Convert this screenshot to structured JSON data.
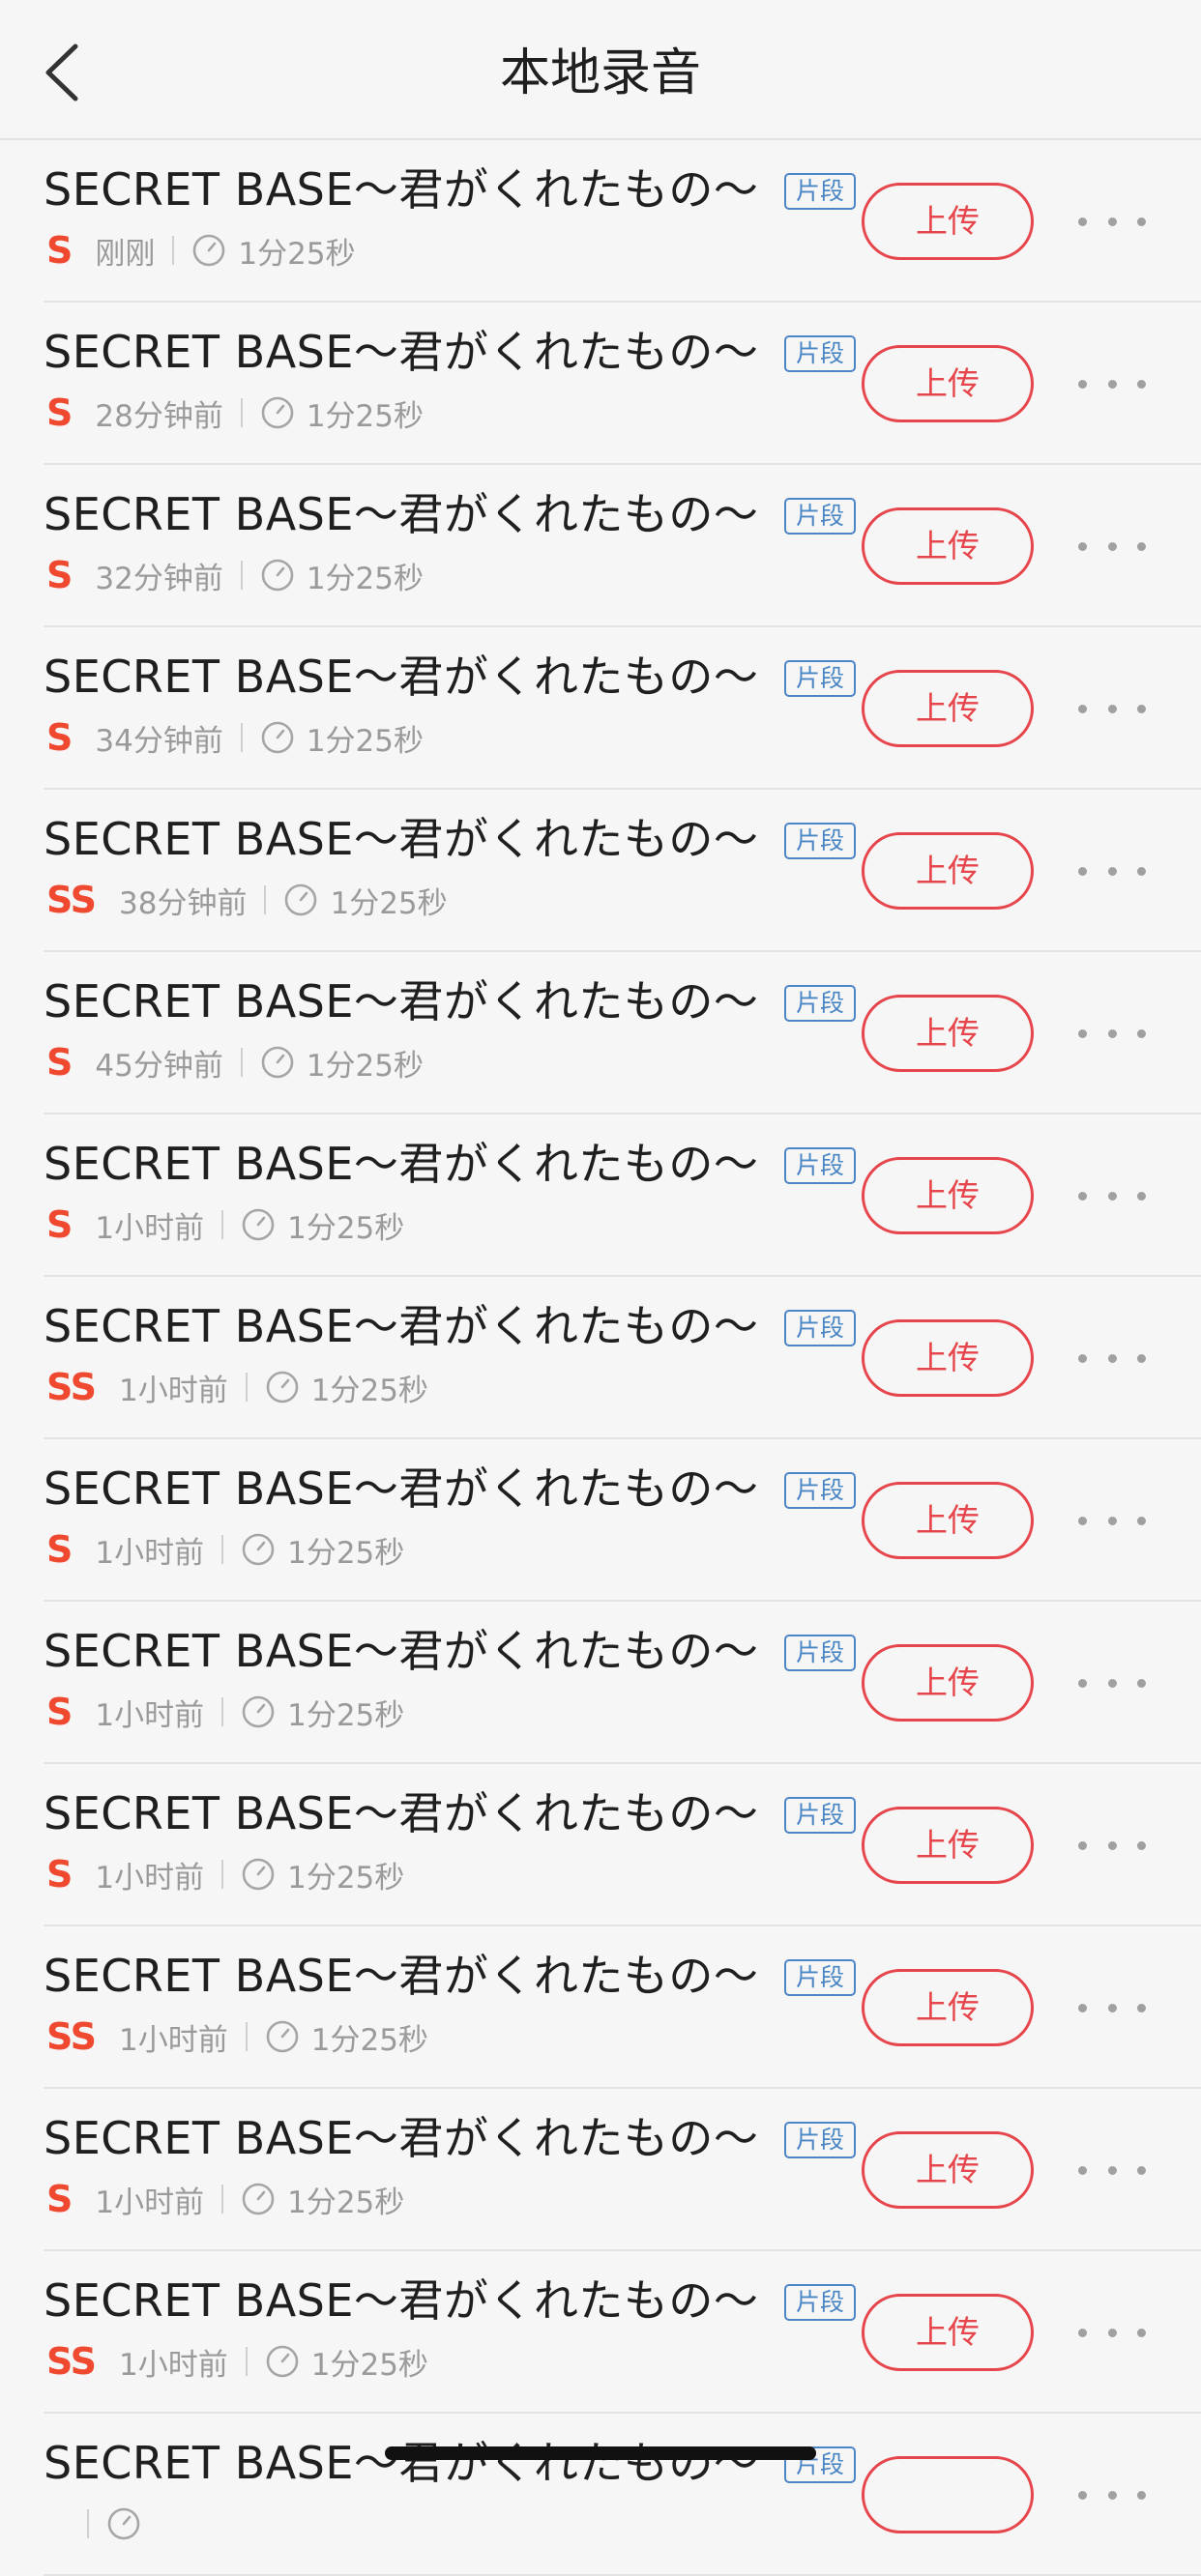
{
  "header": {
    "title": "本地录音",
    "back_icon": "chevron-left-icon"
  },
  "colors": {
    "accent_red": "#e6454b",
    "quality_orange": "#ef4a30",
    "tag_blue": "#4a86c4",
    "meta_gray": "#9a9a9a"
  },
  "recordings": [
    {
      "title": "SECRET BASE～君がくれたもの～",
      "tag": "片段",
      "quality": "S",
      "time": "刚刚",
      "duration": "1分25秒",
      "upload_label": "上传"
    },
    {
      "title": "SECRET BASE～君がくれたもの～",
      "tag": "片段",
      "quality": "S",
      "time": "28分钟前",
      "duration": "1分25秒",
      "upload_label": "上传"
    },
    {
      "title": "SECRET BASE～君がくれたもの～",
      "tag": "片段",
      "quality": "S",
      "time": "32分钟前",
      "duration": "1分25秒",
      "upload_label": "上传"
    },
    {
      "title": "SECRET BASE～君がくれたもの～",
      "tag": "片段",
      "quality": "S",
      "time": "34分钟前",
      "duration": "1分25秒",
      "upload_label": "上传"
    },
    {
      "title": "SECRET BASE～君がくれたもの～",
      "tag": "片段",
      "quality": "SS",
      "time": "38分钟前",
      "duration": "1分25秒",
      "upload_label": "上传"
    },
    {
      "title": "SECRET BASE～君がくれたもの～",
      "tag": "片段",
      "quality": "S",
      "time": "45分钟前",
      "duration": "1分25秒",
      "upload_label": "上传"
    },
    {
      "title": "SECRET BASE～君がくれたもの～",
      "tag": "片段",
      "quality": "S",
      "time": "1小时前",
      "duration": "1分25秒",
      "upload_label": "上传"
    },
    {
      "title": "SECRET BASE～君がくれたもの～",
      "tag": "片段",
      "quality": "SS",
      "time": "1小时前",
      "duration": "1分25秒",
      "upload_label": "上传"
    },
    {
      "title": "SECRET BASE～君がくれたもの～",
      "tag": "片段",
      "quality": "S",
      "time": "1小时前",
      "duration": "1分25秒",
      "upload_label": "上传"
    },
    {
      "title": "SECRET BASE～君がくれたもの～",
      "tag": "片段",
      "quality": "S",
      "time": "1小时前",
      "duration": "1分25秒",
      "upload_label": "上传"
    },
    {
      "title": "SECRET BASE～君がくれたもの～",
      "tag": "片段",
      "quality": "S",
      "time": "1小时前",
      "duration": "1分25秒",
      "upload_label": "上传"
    },
    {
      "title": "SECRET BASE～君がくれたもの～",
      "tag": "片段",
      "quality": "SS",
      "time": "1小时前",
      "duration": "1分25秒",
      "upload_label": "上传"
    },
    {
      "title": "SECRET BASE～君がくれたもの～",
      "tag": "片段",
      "quality": "S",
      "time": "1小时前",
      "duration": "1分25秒",
      "upload_label": "上传"
    },
    {
      "title": "SECRET BASE～君がくれたもの～",
      "tag": "片段",
      "quality": "SS",
      "time": "1小时前",
      "duration": "1分25秒",
      "upload_label": "上传"
    },
    {
      "title": "SECRET BASE～君がくれたもの～",
      "tag": "片段",
      "quality": "",
      "time": "",
      "duration": "",
      "upload_label": ""
    }
  ]
}
